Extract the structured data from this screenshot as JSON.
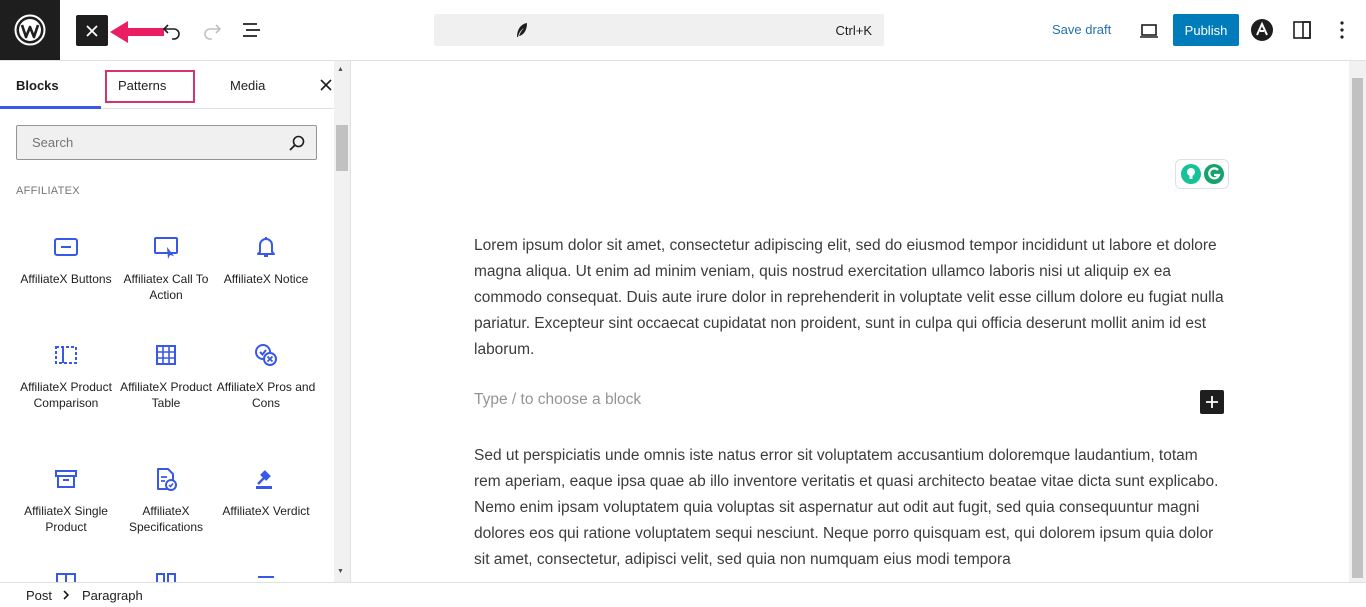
{
  "header": {
    "logo_icon": "wordpress-logo-icon",
    "close_icon": "close-icon",
    "command_shortcut": "Ctrl+K",
    "save_draft": "Save draft",
    "publish": "Publish",
    "accent_color": "#007cba",
    "link_color": "#2271b1"
  },
  "inserter": {
    "tabs": [
      "Blocks",
      "Patterns",
      "Media"
    ],
    "active_tab": "Blocks",
    "search_placeholder": "Search",
    "category": "AFFILIATEX",
    "blocks": [
      {
        "label": "AffiliateX Buttons",
        "icon": "button-icon"
      },
      {
        "label": "Affiliatex Call To Action",
        "icon": "call-to-action-icon"
      },
      {
        "label": "AffiliateX Notice",
        "icon": "bell-icon"
      },
      {
        "label": "AffiliateX Product Comparison",
        "icon": "comparison-icon"
      },
      {
        "label": "AffiliateX Product Table",
        "icon": "table-icon"
      },
      {
        "label": "AffiliateX Pros and Cons",
        "icon": "pros-cons-icon"
      },
      {
        "label": "AffiliateX Single Product",
        "icon": "box-icon"
      },
      {
        "label": "AffiliateX Specifications",
        "icon": "specifications-icon"
      },
      {
        "label": "AffiliateX Verdict",
        "icon": "gavel-icon"
      }
    ],
    "highlight_color": "#d6336c"
  },
  "editor": {
    "paragraph1": "Lorem ipsum dolor sit amet, consectetur adipiscing elit, sed do eiusmod tempor incididunt ut labore et dolore magna aliqua. Ut enim ad minim veniam, quis nostrud exercitation ullamco laboris nisi ut aliquip ex ea commodo consequat. Duis aute irure dolor in reprehenderit in voluptate velit esse cillum dolore eu fugiat nulla pariatur. Excepteur sint occaecat cupidatat non proident, sunt in culpa qui officia deserunt mollit anim id est laborum.",
    "placeholder": "Type / to choose a block",
    "paragraph2": "Sed ut perspiciatis unde omnis iste natus error sit voluptatem accusantium doloremque laudantium, totam rem aperiam, eaque ipsa quae ab illo inventore veritatis et quasi architecto beatae vitae dicta sunt explicabo. Nemo enim ipsam voluptatem quia voluptas sit aspernatur aut odit aut fugit, sed quia consequuntur magni dolores eos qui ratione voluptatem sequi nesciunt. Neque porro quisquam est, qui dolorem ipsum quia dolor sit amet, consectetur, adipisci velit, sed quia non numquam eius modi tempora"
  },
  "breadcrumb": {
    "items": [
      "Post",
      "Paragraph"
    ]
  }
}
